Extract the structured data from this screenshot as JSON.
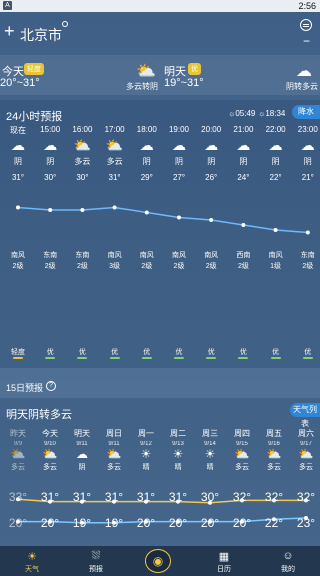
{
  "status_bar": {
    "notification": "A",
    "time": "2:56"
  },
  "header": {
    "add_icon": "plus-icon",
    "city": "北京市",
    "more_icon": "more-icon",
    "minus": "−"
  },
  "today": {
    "label": "今天",
    "aqi_badge": "轻度",
    "temp": "20°~31°",
    "condition": "多云转阴",
    "icon": "partly-cloudy-icon"
  },
  "tomorrow": {
    "label": "明天",
    "aqi_badge": "优",
    "temp": "19°~31°",
    "condition": "阴转多云",
    "icon": "cloudy-icon"
  },
  "hourly": {
    "title": "24小时预报",
    "sunrise": "05:49",
    "sunset": "18:34",
    "rain_button": "降水",
    "items": [
      {
        "time": "现在",
        "icon": "cloud-icon",
        "cond": "阴",
        "temp": "31°",
        "wind_dir": "南风",
        "wind_lvl": "2级",
        "aqi": "轻度"
      },
      {
        "time": "15:00",
        "icon": "cloud-icon",
        "cond": "阴",
        "temp": "30°",
        "wind_dir": "东南",
        "wind_lvl": "2级",
        "aqi": "优"
      },
      {
        "time": "16:00",
        "icon": "partly-cloudy-icon",
        "cond": "多云",
        "temp": "30°",
        "wind_dir": "东南",
        "wind_lvl": "2级",
        "aqi": "优"
      },
      {
        "time": "17:00",
        "icon": "partly-cloudy-icon",
        "cond": "多云",
        "temp": "31°",
        "wind_dir": "南风",
        "wind_lvl": "3级",
        "aqi": "优"
      },
      {
        "time": "18:00",
        "icon": "cloud-icon",
        "cond": "阴",
        "temp": "29°",
        "wind_dir": "南风",
        "wind_lvl": "2级",
        "aqi": "优"
      },
      {
        "time": "19:00",
        "icon": "cloud-icon",
        "cond": "阴",
        "temp": "27°",
        "wind_dir": "南风",
        "wind_lvl": "2级",
        "aqi": "优"
      },
      {
        "time": "20:00",
        "icon": "cloud-icon",
        "cond": "阴",
        "temp": "26°",
        "wind_dir": "南风",
        "wind_lvl": "2级",
        "aqi": "优"
      },
      {
        "time": "21:00",
        "icon": "cloud-icon",
        "cond": "阴",
        "temp": "24°",
        "wind_dir": "西南",
        "wind_lvl": "2级",
        "aqi": "优"
      },
      {
        "time": "22:00",
        "icon": "cloud-icon",
        "cond": "阴",
        "temp": "22°",
        "wind_dir": "南风",
        "wind_lvl": "1级",
        "aqi": "优"
      },
      {
        "time": "23:00",
        "icon": "cloud-icon",
        "cond": "阴",
        "temp": "21°",
        "wind_dir": "东南",
        "wind_lvl": "2级",
        "aqi": "优"
      }
    ]
  },
  "forecast_header": {
    "title": "15日预报",
    "help": "?"
  },
  "daily": {
    "title": "明天阴转多云",
    "button": "天气列表",
    "items": [
      {
        "name": "昨天",
        "date": "9/9",
        "icon": "partly-cloudy-icon",
        "cond": "多云",
        "hi": "33°",
        "lo": "20°",
        "dim": true
      },
      {
        "name": "今天",
        "date": "9/10",
        "icon": "partly-cloudy-icon",
        "cond": "多云",
        "hi": "31°",
        "lo": "20°"
      },
      {
        "name": "明天",
        "date": "9/11",
        "icon": "cloud-icon",
        "cond": "阴",
        "hi": "31°",
        "lo": "19°"
      },
      {
        "name": "周日",
        "date": "9/11",
        "icon": "partly-cloudy-icon",
        "cond": "多云",
        "hi": "31°",
        "lo": "19°"
      },
      {
        "name": "周一",
        "date": "9/12",
        "icon": "sun-icon",
        "cond": "晴",
        "hi": "31°",
        "lo": "20°"
      },
      {
        "name": "周二",
        "date": "9/13",
        "icon": "sun-icon",
        "cond": "晴",
        "hi": "31°",
        "lo": "20°"
      },
      {
        "name": "周三",
        "date": "9/14",
        "icon": "sun-icon",
        "cond": "晴",
        "hi": "30°",
        "lo": "20°"
      },
      {
        "name": "周四",
        "date": "9/15",
        "icon": "partly-cloudy-icon",
        "cond": "多云",
        "hi": "32°",
        "lo": "20°"
      },
      {
        "name": "周五",
        "date": "9/16",
        "icon": "partly-cloudy-icon",
        "cond": "多云",
        "hi": "32°",
        "lo": "22°"
      },
      {
        "name": "周六",
        "date": "9/17",
        "icon": "partly-cloudy-icon",
        "cond": "多云",
        "hi": "32°",
        "lo": "23°"
      }
    ]
  },
  "bottom_nav": [
    {
      "label": "天气",
      "icon": "weather-icon",
      "active": true
    },
    {
      "label": "预报",
      "icon": "forecast-icon"
    },
    {
      "label": "",
      "icon": "voice-icon"
    },
    {
      "label": "日历",
      "icon": "calendar-icon"
    },
    {
      "label": "我的",
      "icon": "profile-icon"
    }
  ],
  "chart_data": {
    "type": "line",
    "categories": [
      "现在",
      "15:00",
      "16:00",
      "17:00",
      "18:00",
      "19:00",
      "20:00",
      "21:00",
      "22:00",
      "23:00"
    ],
    "values": [
      31,
      30,
      30,
      31,
      29,
      27,
      26,
      24,
      22,
      21
    ]
  },
  "colors": {
    "accent": "#2f86d6",
    "badge": "#e9c437",
    "line": "#6fb7ff",
    "hi_line": "#f2c94c",
    "lo_line": "#7fc7ff"
  }
}
